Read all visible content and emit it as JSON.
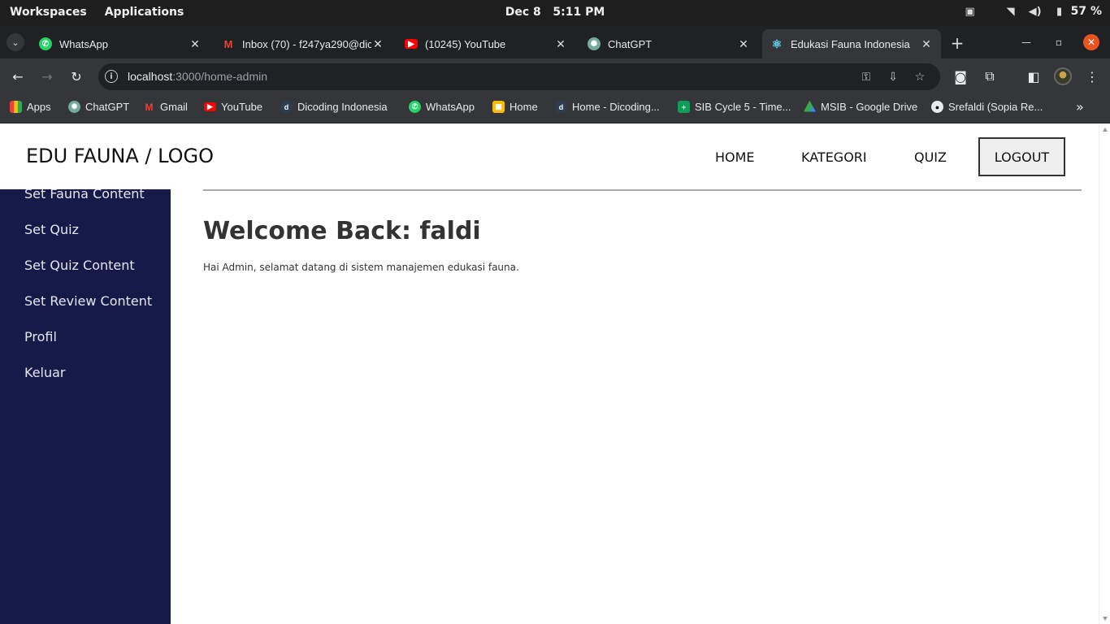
{
  "os_bar": {
    "workspaces": "Workspaces",
    "applications": "Applications",
    "date": "Dec 8",
    "time": "5:11 PM",
    "battery": "57 %"
  },
  "tabs": [
    {
      "title": "WhatsApp",
      "favicon": "whatsapp-icon",
      "color": "#25d366"
    },
    {
      "title": "Inbox (70) - f247ya290@dic",
      "favicon": "gmail-icon",
      "color": "#ea4335"
    },
    {
      "title": "(10245) YouTube",
      "favicon": "youtube-icon",
      "color": "#ff0000"
    },
    {
      "title": "ChatGPT",
      "favicon": "chatgpt-icon",
      "color": "#74aa9c"
    },
    {
      "title": "Edukasi Fauna Indonesia",
      "favicon": "react-icon",
      "color": "#61dafb",
      "active": true
    }
  ],
  "address_bar": {
    "host": "localhost",
    "path": ":3000/home-admin"
  },
  "bookmarks": [
    {
      "label": "Apps",
      "icon": "apps-grid-icon"
    },
    {
      "label": "ChatGPT",
      "icon": "chatgpt-icon"
    },
    {
      "label": "Gmail",
      "icon": "gmail-icon"
    },
    {
      "label": "YouTube",
      "icon": "youtube-icon"
    },
    {
      "label": "Dicoding Indonesia",
      "icon": "dicoding-icon"
    },
    {
      "label": "WhatsApp",
      "icon": "whatsapp-icon"
    },
    {
      "label": "Home",
      "icon": "classroom-icon"
    },
    {
      "label": "Home - Dicoding...",
      "icon": "dicoding-icon"
    },
    {
      "label": "SIB Cycle 5 - Time...",
      "icon": "sheets-icon"
    },
    {
      "label": "MSIB - Google Drive",
      "icon": "drive-icon"
    },
    {
      "label": "Srefaldi (Sopia Re...",
      "icon": "github-icon"
    }
  ],
  "site": {
    "logo": "EDU FAUNA / LOGO",
    "nav": {
      "home": "HOME",
      "kategori": "KATEGORI",
      "quiz": "QUIZ",
      "logout": "LOGOUT"
    },
    "sidebar": [
      "Set Fauna Content",
      "Set Quiz",
      "Set Quiz Content",
      "Set Review Content",
      "Profil",
      "Keluar"
    ],
    "welcome": "Welcome Back: faldi",
    "description": "Hai Admin, selamat datang di sistem manajemen edukasi fauna."
  },
  "colors": {
    "sidebar_bg": "#161a48",
    "logout_close": "#e95420"
  }
}
